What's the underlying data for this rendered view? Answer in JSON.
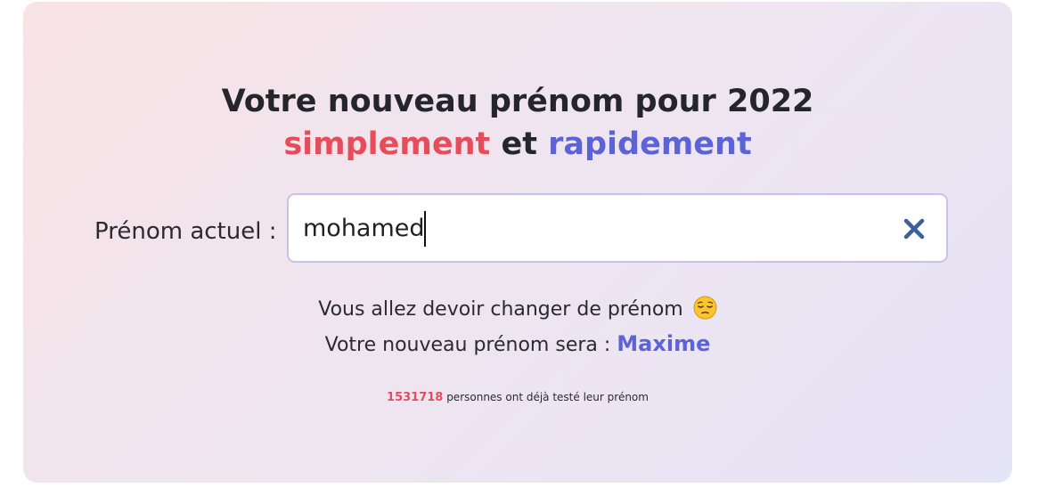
{
  "heading": {
    "line1": "Votre nouveau prénom pour 2022",
    "word_simply": "simplement",
    "word_and": "et",
    "word_quickly": "rapidement"
  },
  "form": {
    "label": "Prénom actuel :",
    "value": "mohamed",
    "clear_icon": "close-icon"
  },
  "result": {
    "message": "Vous allez devoir changer de prénom",
    "emoji": "pensive-face-icon",
    "new_name_prefix": "Votre nouveau prénom sera :",
    "new_name": "Maxime"
  },
  "stats": {
    "count": "1531718",
    "suffix": "personnes ont déjà testé leur prénom"
  },
  "colors": {
    "accent_red": "#e74c5a",
    "accent_blue": "#5b63d6",
    "clear_icon": "#3b5f9a"
  }
}
